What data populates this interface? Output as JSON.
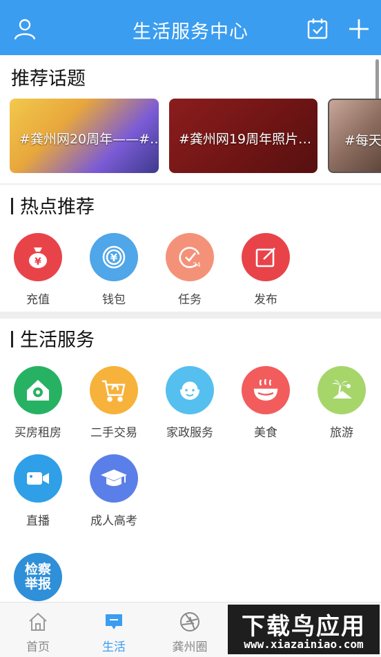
{
  "header": {
    "title": "生活服务中心"
  },
  "topics": {
    "title": "推荐话题",
    "cards": [
      {
        "caption": "#龚州网20周年——#…"
      },
      {
        "caption": "#龚州网19周年照片…"
      },
      {
        "caption": "#每天"
      }
    ]
  },
  "hot": {
    "title": "热点推荐",
    "items": [
      {
        "label": "充值",
        "color": "#e9434a",
        "icon": "money-bag-icon"
      },
      {
        "label": "钱包",
        "color": "#4fa6e8",
        "icon": "wallet-icon"
      },
      {
        "label": "任务",
        "color": "#f49279",
        "icon": "task-icon"
      },
      {
        "label": "发布",
        "color": "#e9434a",
        "icon": "edit-icon"
      }
    ]
  },
  "services": {
    "title": "生活服务",
    "items": [
      {
        "label": "买房租房",
        "color": "#27b263",
        "icon": "house-icon"
      },
      {
        "label": "二手交易",
        "color": "#f7b23b",
        "icon": "cart-icon"
      },
      {
        "label": "家政服务",
        "color": "#55bff0",
        "icon": "housekeeping-icon"
      },
      {
        "label": "美食",
        "color": "#f25c5c",
        "icon": "food-bowl-icon"
      },
      {
        "label": "旅游",
        "color": "#a6d66a",
        "icon": "travel-icon"
      },
      {
        "label": "直播",
        "color": "#2f9fe8",
        "icon": "video-camera-icon"
      },
      {
        "label": "成人高考",
        "color": "#5b7fe8",
        "icon": "graduation-cap-icon"
      }
    ],
    "report_badge": {
      "line1": "检察",
      "line2": "举报"
    }
  },
  "bottom_nav": [
    {
      "label": "首页",
      "icon": "home-icon"
    },
    {
      "label": "生活",
      "icon": "chat-bubble-icon",
      "active": true
    },
    {
      "label": "龚州圈",
      "icon": "aperture-icon"
    }
  ],
  "watermark": {
    "title": "下载鸟应用",
    "url": "www.xiazainiao.com"
  }
}
